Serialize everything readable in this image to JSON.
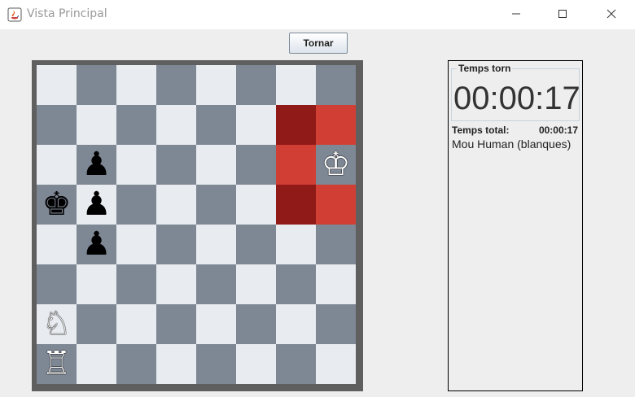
{
  "window": {
    "title": "Vista Principal"
  },
  "toolbar": {
    "back_label": "Tornar"
  },
  "colors": {
    "light_square": "#e8ebef",
    "dark_square": "#7e8794",
    "highlight_dark": "#8f1a17",
    "highlight_light": "#d13f34"
  },
  "board": {
    "rows": [
      [
        null,
        null,
        null,
        null,
        null,
        null,
        null,
        null
      ],
      [
        null,
        null,
        null,
        null,
        null,
        null,
        null,
        null
      ],
      [
        null,
        {
          "piece": "pawn",
          "color": "black",
          "glyph": "♟"
        },
        null,
        null,
        null,
        null,
        null,
        {
          "piece": "king",
          "color": "white",
          "glyph": "♔"
        }
      ],
      [
        {
          "piece": "king",
          "color": "black",
          "glyph": "♚"
        },
        {
          "piece": "pawn",
          "color": "black",
          "glyph": "♟"
        },
        null,
        null,
        null,
        null,
        null,
        null
      ],
      [
        null,
        {
          "piece": "pawn",
          "color": "black",
          "glyph": "♟"
        },
        null,
        null,
        null,
        null,
        null,
        null
      ],
      [
        null,
        null,
        null,
        null,
        null,
        null,
        null,
        null
      ],
      [
        {
          "piece": "knight",
          "color": "white",
          "glyph": "♘"
        },
        null,
        null,
        null,
        null,
        null,
        null,
        null
      ],
      [
        {
          "piece": "rook",
          "color": "white",
          "glyph": "♖"
        },
        null,
        null,
        null,
        null,
        null,
        null,
        null
      ]
    ],
    "highlight_dark": [
      [
        1,
        6
      ],
      [
        3,
        6
      ]
    ],
    "highlight_light": [
      [
        1,
        7
      ],
      [
        2,
        6
      ],
      [
        3,
        7
      ]
    ]
  },
  "panel": {
    "turn_label": "Temps torn",
    "turn_time": "00:00:17",
    "total_label": "Temps total:",
    "total_time": "00:00:17",
    "player": "Mou Human (blanques)"
  }
}
